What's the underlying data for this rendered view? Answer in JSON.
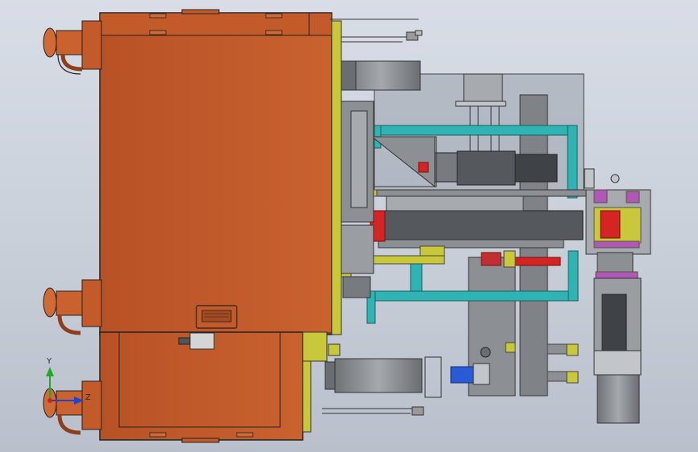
{
  "viewport": {
    "title": "",
    "view_orientation": "front",
    "background": [
      "#d8dde6",
      "#b9c0cb"
    ]
  },
  "colors": {
    "housing": "#c0592b",
    "housing_dark": "#8e3e1b",
    "yellow_plate": "#c8c83a",
    "teal_frame": "#2fb3b3",
    "red_part": "#d42424",
    "magenta_part": "#b058b8",
    "grey_part": "#8c8f94",
    "dark_grey": "#55585c",
    "glass": "#9aa2ad"
  },
  "triad": {
    "y_label": "Y",
    "z_label": "Z"
  },
  "icons": [
    "coordinate-triad-icon"
  ]
}
